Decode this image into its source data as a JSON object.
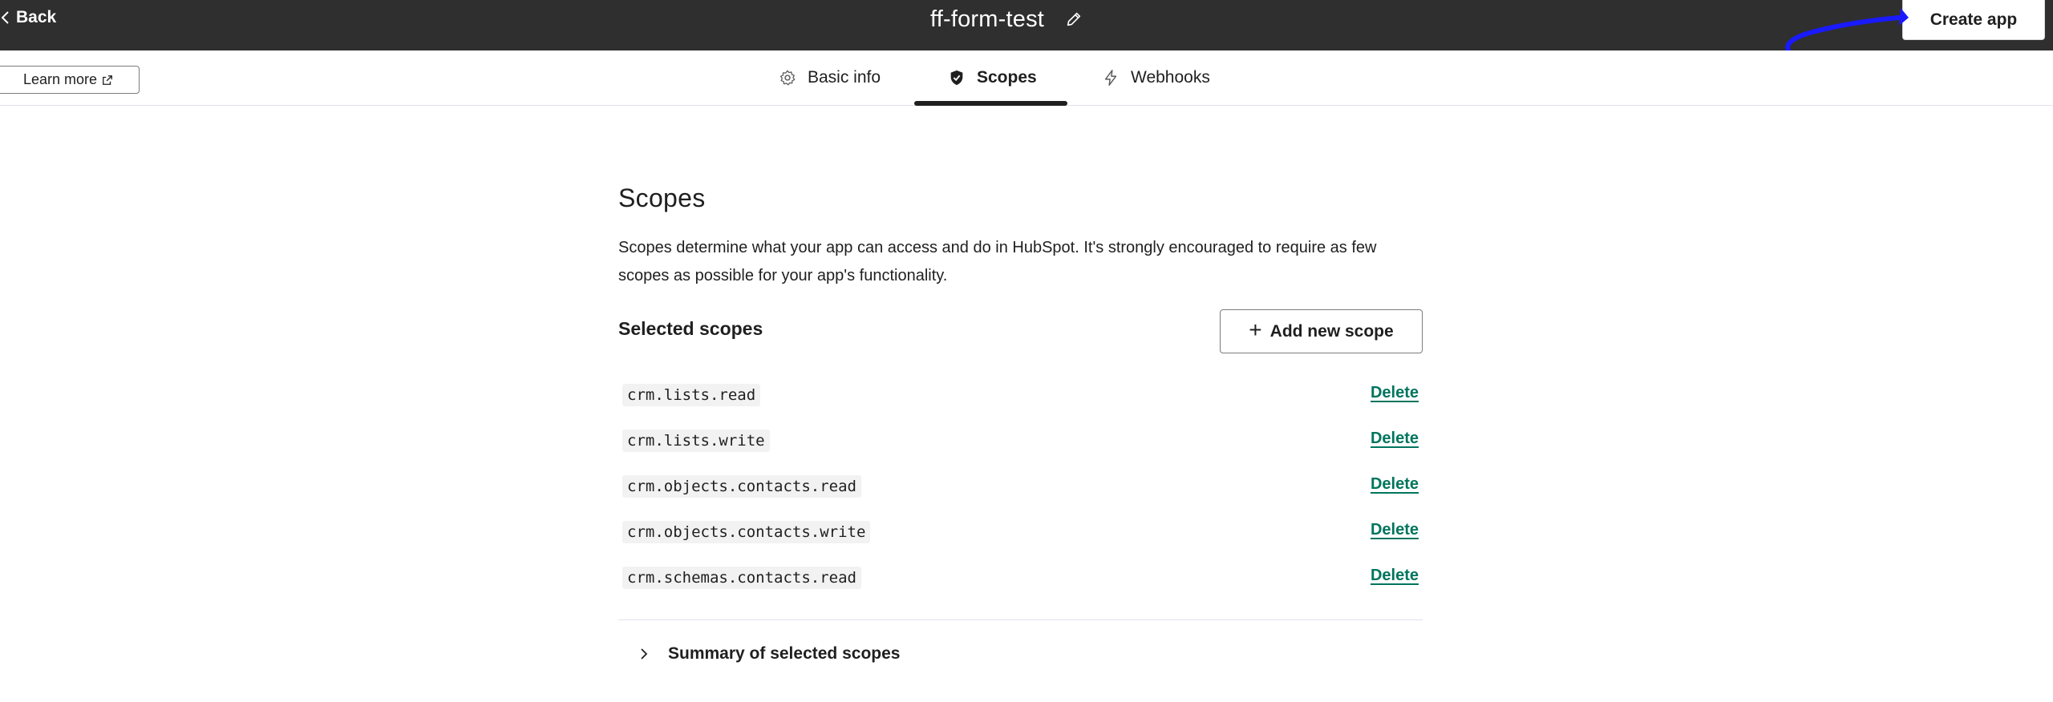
{
  "header": {
    "back_label": "Back",
    "app_title": "ff-form-test",
    "create_app_label": "Create app"
  },
  "subnav": {
    "learn_more_label": "Learn more",
    "tabs": [
      {
        "label": "Basic info",
        "icon": "gear-icon",
        "active": false
      },
      {
        "label": "Scopes",
        "icon": "shield-check-icon",
        "active": true
      },
      {
        "label": "Webhooks",
        "icon": "lightning-icon",
        "active": false
      }
    ]
  },
  "main": {
    "title": "Scopes",
    "description": "Scopes determine what your app can access and do in HubSpot. It's strongly encouraged to require as few scopes as possible for your app's functionality.",
    "selected_scopes_label": "Selected scopes",
    "add_scope_label": "Add new scope",
    "scopes": [
      {
        "name": "crm.lists.read",
        "action": "Delete"
      },
      {
        "name": "crm.lists.write",
        "action": "Delete"
      },
      {
        "name": "crm.objects.contacts.read",
        "action": "Delete"
      },
      {
        "name": "crm.objects.contacts.write",
        "action": "Delete"
      },
      {
        "name": "crm.schemas.contacts.read",
        "action": "Delete"
      }
    ],
    "summary_label": "Summary of selected scopes"
  },
  "colors": {
    "header_bg": "#2f2f2f",
    "link_green": "#00755d",
    "annotation_arrow": "#1a1aff"
  }
}
